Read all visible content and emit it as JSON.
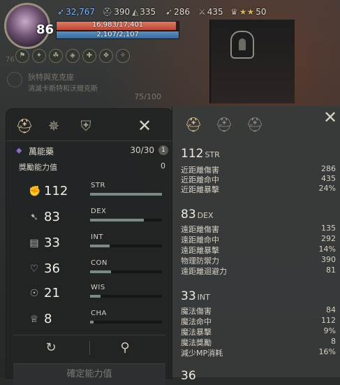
{
  "hud": {
    "level": "86",
    "gold": "32,767",
    "res2": "390",
    "res3": "335",
    "res4": "286",
    "res5": "435",
    "res6": "50",
    "hp_text": "16,983/17,401",
    "hp_fraction": 0.976,
    "mp_text": "2,107/2,107",
    "mp_fraction": 1.0,
    "buffs": [
      "76",
      "",
      "",
      "",
      "",
      "",
      ""
    ]
  },
  "quest": {
    "title": "狄特與克克座",
    "desc": "消滅卡斯特和沃爾克斯",
    "progress": "75/100"
  },
  "left_panel": {
    "elixir_label": "萬能藥",
    "elixir_count": "30/30",
    "elixir_info": "1",
    "bonus_label": "獎勵能力值",
    "bonus_value": "0",
    "stats": [
      {
        "value": "112",
        "name": "STR",
        "icon": "fist-icon",
        "fill": 1.0
      },
      {
        "value": "83",
        "name": "DEX",
        "icon": "boot-icon",
        "fill": 0.75
      },
      {
        "value": "33",
        "name": "INT",
        "icon": "book-icon",
        "fill": 0.27
      },
      {
        "value": "36",
        "name": "CON",
        "icon": "heart-icon",
        "fill": 0.29
      },
      {
        "value": "21",
        "name": "WIS",
        "icon": "head-icon",
        "fill": 0.15
      },
      {
        "value": "8",
        "name": "CHA",
        "icon": "crown-icon",
        "fill": 0.05
      }
    ],
    "confirm_label": "確定能力值"
  },
  "right_panel": {
    "sections": [
      {
        "value": "112",
        "name": "STR",
        "rows": [
          {
            "k": "近距離傷害",
            "v": "286"
          },
          {
            "k": "近距離命中",
            "v": "435"
          },
          {
            "k": "近距離暴擊",
            "v": "24%"
          }
        ]
      },
      {
        "value": "83",
        "name": "DEX",
        "rows": [
          {
            "k": "遠距離傷害",
            "v": "135"
          },
          {
            "k": "遠距離命中",
            "v": "292"
          },
          {
            "k": "遠距離暴擊",
            "v": "14%"
          },
          {
            "k": "物理防禦力",
            "v": "390"
          },
          {
            "k": "遠距離迴避力",
            "v": "81"
          }
        ]
      },
      {
        "value": "33",
        "name": "INT",
        "rows": [
          {
            "k": "魔法傷害",
            "v": "84"
          },
          {
            "k": "魔法命中",
            "v": "112"
          },
          {
            "k": "魔法暴擊",
            "v": "9%"
          },
          {
            "k": "魔法獎勵",
            "v": "8"
          },
          {
            "k": "減少MP消耗",
            "v": "16%"
          }
        ]
      },
      {
        "value": "36",
        "name": "",
        "rows": []
      }
    ]
  }
}
